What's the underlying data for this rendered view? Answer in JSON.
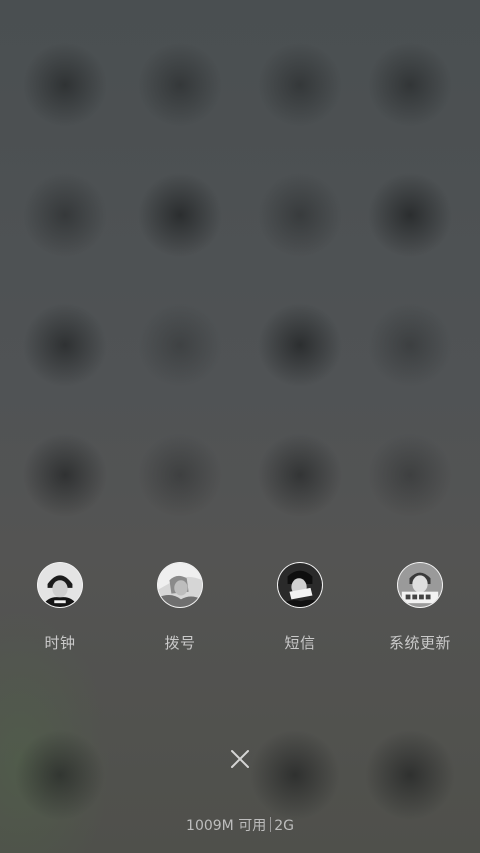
{
  "recent_apps": [
    {
      "label": "时钟",
      "thumbnail": "profile-photo-hat"
    },
    {
      "label": "拨号",
      "thumbnail": "profile-photo-light"
    },
    {
      "label": "短信",
      "thumbnail": "profile-photo-dark"
    },
    {
      "label": "系统更新",
      "thumbnail": "profile-photo-banner"
    }
  ],
  "close_icon": "close-x-icon",
  "memory": {
    "available": "1009M 可用",
    "total": "2G"
  },
  "colors": {
    "label_text": "#c9c9c9",
    "memory_text": "#bdbdbd"
  }
}
